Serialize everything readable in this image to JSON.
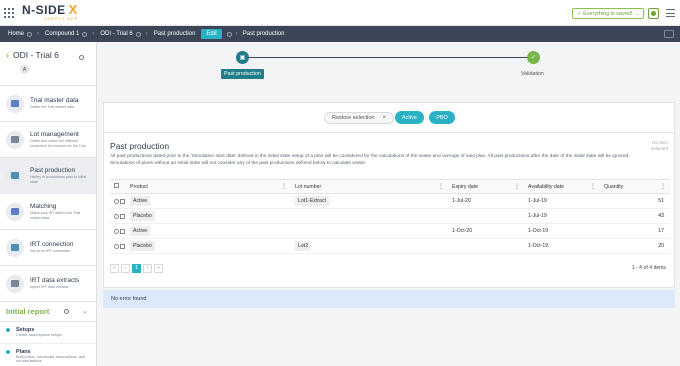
{
  "app": {
    "logo_text": "N-SIDE",
    "logo_mark": "X",
    "logo_sub": "SUPPLY APP",
    "saved_status": "Everything is saved!"
  },
  "breadcrumb": {
    "home": "Home",
    "compound": "Compound 1",
    "trial": "ODI - Trial 6",
    "section": "Past production",
    "edit": "Edit",
    "current": "Past production"
  },
  "sidebar": {
    "title": "ODI - Trial 6",
    "avatar": "A",
    "items": [
      {
        "label": "Trial master data",
        "desc": "Define the Trial master data",
        "color": "#5b7fc7"
      },
      {
        "label": "Lot management",
        "desc": "Define and match the different production lot numbers for the Trial",
        "color": "#7c8696"
      },
      {
        "label": "Past production",
        "desc": "History of productions prior to initial state",
        "color": "#4d8fb5"
      },
      {
        "label": "Matching",
        "desc": "Match your IRT data to the Trial master data",
        "color": "#5b7fc7"
      },
      {
        "label": "IRT connection",
        "desc": "Set up an IRT connection",
        "color": "#4d8fb5"
      },
      {
        "label": "IRT data extracts",
        "desc": "Import IRT data extracts",
        "color": "#7c8696"
      }
    ],
    "report": {
      "label": "Initial report",
      "subs": [
        {
          "label": "Setups",
          "desc": "Create assumptions setups",
          "color": "#29b1c4"
        },
        {
          "label": "Plans",
          "desc": "Build plans, reevaluate assumptions, and run simulations",
          "color": "#29b1c4"
        }
      ]
    }
  },
  "stepper": {
    "step1": "Past production",
    "step2": "Validation"
  },
  "toolbar": {
    "restore": "Restore selection",
    "active": "Active",
    "pbo": "PBO"
  },
  "card": {
    "title": "Past production",
    "no_item": "No item selected",
    "desc": "All past productions dated prior to the 'Simulation start date' defined in the initial state setup of a plan will be considered for the calculations of the waste and overage of said plan. All past productions after the date of the initial state will be ignored. Simulations of plans without an initial state will not consider any of the past productions defined below to calculate waste."
  },
  "table": {
    "headers": [
      "Product",
      "Lot number",
      "Expiry date",
      "Availability date",
      "Quantity"
    ],
    "rows": [
      {
        "product": "Active",
        "lot": "Lot1-Extract",
        "expiry": "1-Jul-20",
        "avail": "1-Jul-19",
        "qty": "51"
      },
      {
        "product": "Placebo",
        "lot": "",
        "expiry": "",
        "avail": "1-Jul-19",
        "qty": "43"
      },
      {
        "product": "Active",
        "lot": "",
        "expiry": "1-Oct-20",
        "avail": "1-Oct-19",
        "qty": "17"
      },
      {
        "product": "Placebo",
        "lot": "Lot2",
        "expiry": "",
        "avail": "1-Oct-19",
        "qty": "20"
      }
    ]
  },
  "pager": {
    "current": "1",
    "info": "1 - 4 of 4 items"
  },
  "error": "No error found"
}
